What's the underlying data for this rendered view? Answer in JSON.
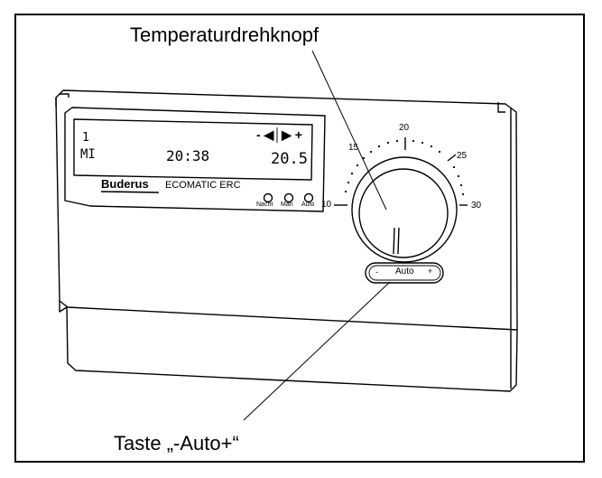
{
  "callouts": {
    "dial_label": "Temperaturdrehknopf",
    "button_label": "Taste „-Auto+“"
  },
  "display": {
    "line1_left": "1",
    "line1_right": "- ◀│▶ +",
    "day": "MI",
    "time": "20:38",
    "temperature": "20.5"
  },
  "brand": {
    "name": "Buderus",
    "model": "ECOMATIC ERC"
  },
  "indicators": [
    "Nacht",
    "Man",
    "Auto"
  ],
  "dial": {
    "scale_labels": [
      "10",
      "15",
      "20",
      "25",
      "30"
    ]
  },
  "auto_button": {
    "minus": "-",
    "label": "Auto",
    "plus": "+"
  }
}
